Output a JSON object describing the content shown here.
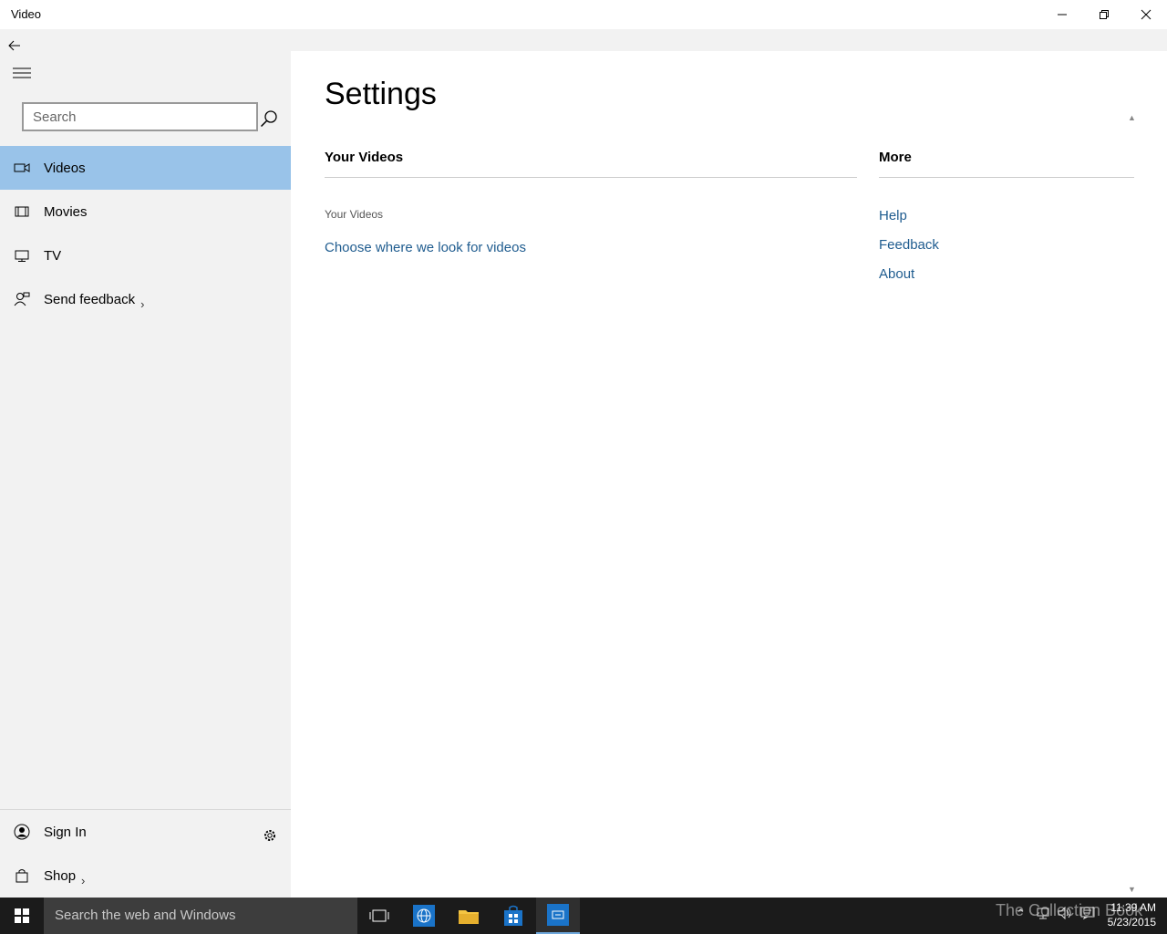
{
  "window": {
    "title": "Video"
  },
  "sidebar": {
    "search": {
      "placeholder": "Search",
      "value": ""
    },
    "nav": [
      {
        "label": "Videos",
        "icon": "video-camera-icon",
        "selected": true
      },
      {
        "label": "Movies",
        "icon": "film-icon",
        "selected": false
      },
      {
        "label": "TV",
        "icon": "tv-icon",
        "selected": false
      },
      {
        "label": "Send feedback",
        "icon": "feedback-person-icon",
        "selected": false,
        "chevron": "›"
      }
    ],
    "bottom": [
      {
        "label": "Sign In",
        "icon": "person-icon"
      },
      {
        "label": "Shop",
        "icon": "shopping-bag-icon",
        "chevron": "›"
      }
    ]
  },
  "main": {
    "page_title": "Settings",
    "sections": {
      "your_videos": {
        "heading": "Your Videos",
        "sub_label": "Your Videos",
        "link": "Choose where we look for videos"
      },
      "more": {
        "heading": "More",
        "links": [
          "Help",
          "Feedback",
          "About"
        ]
      }
    }
  },
  "taskbar": {
    "search_placeholder": "Search the web and Windows",
    "watermark": "The Collection Book",
    "time": "11:39 AM",
    "date": "5/23/2015",
    "accent": "#6fa8dc"
  },
  "colors": {
    "selection": "#99c3e9",
    "link": "#1f5c8f",
    "sidebar_bg": "#f2f2f2",
    "taskbar_bg": "#1b1b1b"
  }
}
